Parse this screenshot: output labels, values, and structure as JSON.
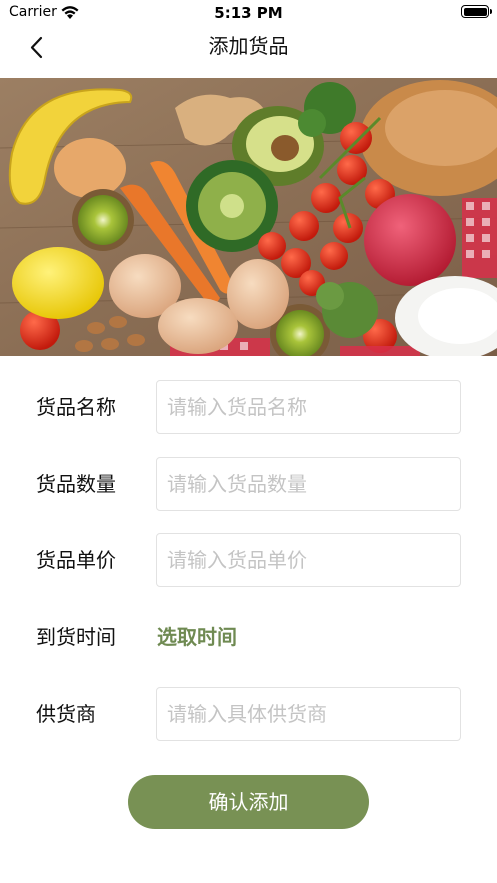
{
  "status": {
    "carrier": "Carrier",
    "time": "5:13 PM"
  },
  "nav": {
    "title": "添加货品",
    "back_icon": "chevron-left-icon"
  },
  "banner": {
    "image": "fresh-produce-photo"
  },
  "form": {
    "fields": [
      {
        "label": "货品名称",
        "placeholder": "请输入货品名称",
        "value": ""
      },
      {
        "label": "货品数量",
        "placeholder": "请输入货品数量",
        "value": ""
      },
      {
        "label": "货品单价",
        "placeholder": "请输入货品单价",
        "value": ""
      }
    ],
    "arrival": {
      "label": "到货时间",
      "action": "选取时间"
    },
    "supplier": {
      "label": "供货商",
      "placeholder": "请输入具体供货商",
      "value": ""
    }
  },
  "confirm_label": "确认添加",
  "colors": {
    "accent": "#789154",
    "link": "#6f8a52",
    "input_border": "#e2e2e2",
    "placeholder": "#c4c4c4"
  }
}
